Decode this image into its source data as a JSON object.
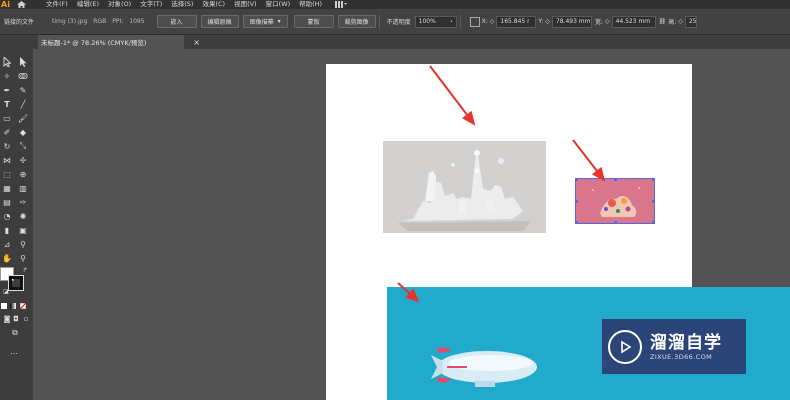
{
  "app": {
    "logo": "Ai"
  },
  "menu": [
    "文件(F)",
    "编辑(E)",
    "对象(O)",
    "文字(T)",
    "选择(S)",
    "效果(C)",
    "视图(V)",
    "窗口(W)",
    "帮助(H)"
  ],
  "control": {
    "linked_file": "链接的文件",
    "filename": "timg (3).jpg",
    "colormode": "RGB",
    "ppi_label": "PPI:",
    "ppi_value": "1095",
    "embed": "嵌入",
    "edit_original": "编辑原稿",
    "image_trace": "图像描摹",
    "mask": "蒙版",
    "crop_image": "裁剪图像",
    "opacity_label": "不透明度",
    "opacity_value": "100%",
    "x_label": "X:",
    "x_value": "165.845 r",
    "y_label": "Y:",
    "y_value": "78.493 mm",
    "w_label": "宽:",
    "w_value": "44.523 mm",
    "h_label": "高:",
    "h_value": "25"
  },
  "tab": {
    "title": "未标题-1* @ 78.26% (CMYK/预览)",
    "close": "×"
  },
  "watermark": {
    "title": "溜溜自学",
    "sub": "ZIXUE.3D66.COM"
  },
  "colors": {
    "accent": "#ff9a00",
    "selection": "#5a66e0",
    "arrow": "#e8332c"
  }
}
